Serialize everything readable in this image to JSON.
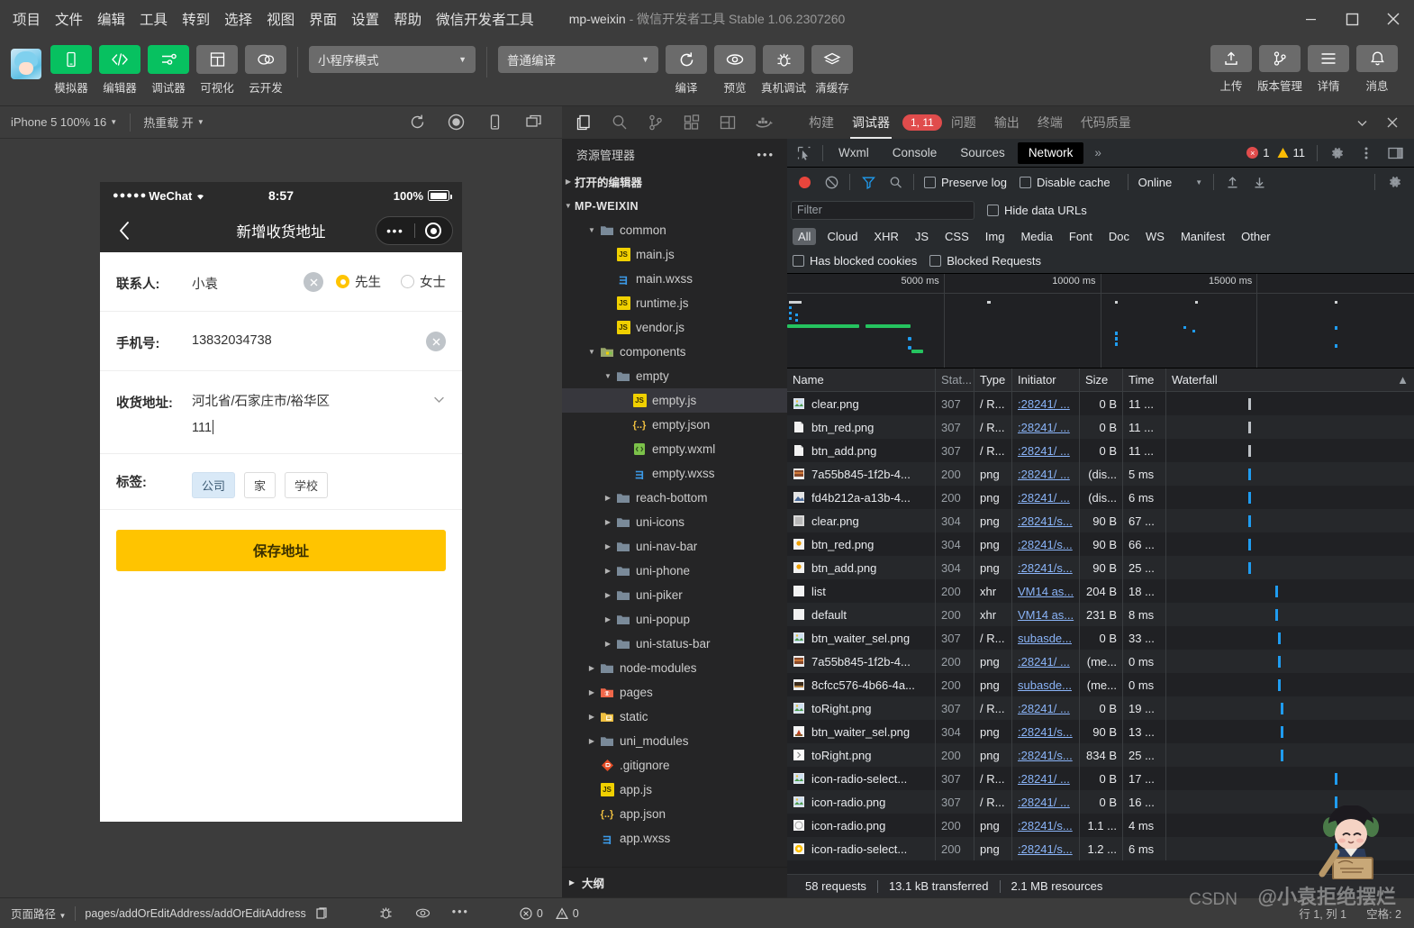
{
  "window": {
    "menu": [
      "项目",
      "文件",
      "编辑",
      "工具",
      "转到",
      "选择",
      "视图",
      "界面",
      "设置",
      "帮助",
      "微信开发者工具"
    ],
    "project_name": "mp-weixin",
    "title_dash": "-",
    "app_title": "微信开发者工具 Stable 1.06.2307260"
  },
  "toolbar": {
    "main_buttons": [
      {
        "label": "模拟器",
        "icon": "phone-icon",
        "style": "green"
      },
      {
        "label": "编辑器",
        "icon": "code-icon",
        "style": "green"
      },
      {
        "label": "调试器",
        "icon": "sliders-icon",
        "style": "green"
      },
      {
        "label": "可视化",
        "icon": "layout-icon",
        "style": "grey"
      },
      {
        "label": "云开发",
        "icon": "cloud-icon",
        "style": "grey"
      }
    ],
    "mode_select": "小程序模式",
    "compile_select": "普通编译",
    "action_buttons": [
      {
        "label": "编译",
        "icon": "refresh-icon"
      },
      {
        "label": "预览",
        "icon": "eye-icon"
      },
      {
        "label": "真机调试",
        "icon": "bug-icon"
      },
      {
        "label": "清缓存",
        "icon": "layers-icon"
      }
    ],
    "right_buttons": [
      {
        "label": "上传",
        "icon": "upload-icon"
      },
      {
        "label": "版本管理",
        "icon": "branch-icon"
      },
      {
        "label": "详情",
        "icon": "menu-icon"
      },
      {
        "label": "消息",
        "icon": "bell-icon"
      }
    ]
  },
  "simulator": {
    "device_select": "iPhone 5 100% 16",
    "hot_reload": "热重载 开",
    "toolbar_icons": [
      "refresh-icon",
      "record-icon",
      "phone-icon",
      "window-icon"
    ],
    "phone": {
      "status_carrier": "WeChat",
      "status_dots": "●●●●●",
      "wifi_icon": "wifi-icon",
      "time": "8:57",
      "battery_pct": "100%",
      "nav_title": "新增收货地址",
      "back_icon": "chevron-left-icon",
      "capsule_more": "•••",
      "capsule_target": "target-icon",
      "form": {
        "contact_label": "联系人:",
        "contact_value": "小袁",
        "clear_icon": "clear-circle-icon",
        "gender_options": [
          {
            "label": "先生",
            "selected": true
          },
          {
            "label": "女士",
            "selected": false
          }
        ],
        "phone_label": "手机号:",
        "phone_value": "13832034738",
        "address_label": "收货地址:",
        "address_region": "河北省/石家庄市/裕华区",
        "address_detail": "111",
        "chevron_icon": "chevron-down-icon",
        "tag_label": "标签:",
        "tags": [
          {
            "label": "公司",
            "selected": true
          },
          {
            "label": "家",
            "selected": false
          },
          {
            "label": "学校",
            "selected": false
          }
        ],
        "save_label": "保存地址"
      }
    }
  },
  "explorer": {
    "activity_icons": [
      "files-icon",
      "search-icon",
      "source-control-icon",
      "extensions-icon",
      "layout-icon",
      "docker-icon"
    ],
    "title": "资源管理器",
    "more_icon": "•••",
    "open_editors": "打开的编辑器",
    "root": "MP-WEIXIN",
    "outline": "大纲",
    "tree": [
      {
        "label": "common",
        "type": "folder",
        "depth": 1,
        "open": true
      },
      {
        "label": "main.js",
        "type": "js",
        "depth": 2
      },
      {
        "label": "main.wxss",
        "type": "css",
        "depth": 2
      },
      {
        "label": "runtime.js",
        "type": "js",
        "depth": 2
      },
      {
        "label": "vendor.js",
        "type": "js",
        "depth": 2
      },
      {
        "label": "components",
        "type": "folder-components",
        "depth": 1,
        "open": true
      },
      {
        "label": "empty",
        "type": "folder",
        "depth": 2,
        "open": true
      },
      {
        "label": "empty.js",
        "type": "js",
        "depth": 3,
        "selected": true
      },
      {
        "label": "empty.json",
        "type": "json",
        "depth": 3
      },
      {
        "label": "empty.wxml",
        "type": "wxml",
        "depth": 3
      },
      {
        "label": "empty.wxss",
        "type": "css",
        "depth": 3
      },
      {
        "label": "reach-bottom",
        "type": "folder",
        "depth": 2,
        "open": false
      },
      {
        "label": "uni-icons",
        "type": "folder",
        "depth": 2,
        "open": false
      },
      {
        "label": "uni-nav-bar",
        "type": "folder",
        "depth": 2,
        "open": false
      },
      {
        "label": "uni-phone",
        "type": "folder",
        "depth": 2,
        "open": false
      },
      {
        "label": "uni-piker",
        "type": "folder",
        "depth": 2,
        "open": false
      },
      {
        "label": "uni-popup",
        "type": "folder",
        "depth": 2,
        "open": false
      },
      {
        "label": "uni-status-bar",
        "type": "folder",
        "depth": 2,
        "open": false
      },
      {
        "label": "node-modules",
        "type": "folder",
        "depth": 1,
        "open": false
      },
      {
        "label": "pages",
        "type": "folder-pages",
        "depth": 1,
        "open": false
      },
      {
        "label": "static",
        "type": "folder-static",
        "depth": 1,
        "open": false
      },
      {
        "label": "uni_modules",
        "type": "folder",
        "depth": 1,
        "open": false
      },
      {
        "label": ".gitignore",
        "type": "git",
        "depth": 1
      },
      {
        "label": "app.js",
        "type": "js",
        "depth": 1
      },
      {
        "label": "app.json",
        "type": "json",
        "depth": 1
      },
      {
        "label": "app.wxss",
        "type": "css",
        "depth": 1
      }
    ]
  },
  "devtools": {
    "tabs": [
      {
        "label": "构建",
        "active": false
      },
      {
        "label": "调试器",
        "active": true,
        "badge": "1, 11"
      },
      {
        "label": "问题",
        "active": false
      },
      {
        "label": "输出",
        "active": false
      },
      {
        "label": "终端",
        "active": false
      },
      {
        "label": "代码质量",
        "active": false
      }
    ],
    "collapse_icon": "chevron-down-icon",
    "close_icon": "close-icon",
    "panel_tabs": [
      {
        "label": "Wxml",
        "selected": false
      },
      {
        "label": "Console",
        "selected": false
      },
      {
        "label": "Sources",
        "selected": false
      },
      {
        "label": "Network",
        "selected": true
      }
    ],
    "more_tabs": "»",
    "inspect_icon": "inspect-icon",
    "error_count": "1",
    "warning_count": "11",
    "settings_icon": "gear-icon",
    "kebab_icon": "kebab-icon",
    "dock_icon": "dock-icon",
    "network": {
      "record_icon": "record-icon",
      "clear_icon": "clear-icon",
      "filter_icon": "filter-icon",
      "search_icon": "search-icon",
      "preserve_log": "Preserve log",
      "disable_cache": "Disable cache",
      "throttle": "Online",
      "import_icon": "upload-arrow-icon",
      "export_icon": "download-arrow-icon",
      "gear_icon": "gear-icon",
      "filter_placeholder": "Filter",
      "hide_data_urls": "Hide data URLs",
      "types": [
        "All",
        "Cloud",
        "XHR",
        "JS",
        "CSS",
        "Img",
        "Media",
        "Font",
        "Doc",
        "WS",
        "Manifest",
        "Other"
      ],
      "selected_type": "All",
      "has_blocked_cookies": "Has blocked cookies",
      "blocked_requests": "Blocked Requests",
      "timeline_ticks": [
        "5000 ms",
        "10000 ms",
        "15000 ms"
      ],
      "columns": [
        "Name",
        "Stat...",
        "Type",
        "Initiator",
        "Size",
        "Time",
        "Waterfall"
      ],
      "sort_icon": "▲",
      "requests": [
        {
          "name": "clear.png",
          "status": "307",
          "type": "/ R...",
          "initiator": ":28241/ ...",
          "size": "0 B",
          "time": "11 ...",
          "icon": "img",
          "wf": 33,
          "wfcolor": "#bdc1c6"
        },
        {
          "name": "btn_red.png",
          "status": "307",
          "type": "/ R...",
          "initiator": ":28241/ ...",
          "size": "0 B",
          "time": "11 ...",
          "icon": "doc",
          "wf": 33,
          "wfcolor": "#bdc1c6"
        },
        {
          "name": "btn_add.png",
          "status": "307",
          "type": "/ R...",
          "initiator": ":28241/ ...",
          "size": "0 B",
          "time": "11 ...",
          "icon": "doc",
          "wf": 33,
          "wfcolor": "#bdc1c6"
        },
        {
          "name": "7a55b845-1f2b-4...",
          "status": "200",
          "type": "png",
          "initiator": ":28241/ ...",
          "size": "(dis...",
          "time": "5 ms",
          "icon": "pic1",
          "wf": 33,
          "wfcolor": "#1f9cf0"
        },
        {
          "name": "fd4b212a-a13b-4...",
          "status": "200",
          "type": "png",
          "initiator": ":28241/ ...",
          "size": "(dis...",
          "time": "6 ms",
          "icon": "pic2",
          "wf": 33,
          "wfcolor": "#1f9cf0"
        },
        {
          "name": "clear.png",
          "status": "304",
          "type": "png",
          "initiator": ":28241/s...",
          "size": "90 B",
          "time": "67 ...",
          "icon": "grey",
          "wf": 33,
          "wfcolor": "#1f9cf0"
        },
        {
          "name": "btn_red.png",
          "status": "304",
          "type": "png",
          "initiator": ":28241/s...",
          "size": "90 B",
          "time": "66 ...",
          "icon": "dot",
          "wf": 33,
          "wfcolor": "#1f9cf0"
        },
        {
          "name": "btn_add.png",
          "status": "304",
          "type": "png",
          "initiator": ":28241/s...",
          "size": "90 B",
          "time": "25 ...",
          "icon": "dot",
          "wf": 33,
          "wfcolor": "#1f9cf0"
        },
        {
          "name": "list",
          "status": "200",
          "type": "xhr",
          "initiator": "VM14 as...",
          "size": "204 B",
          "time": "18 ...",
          "icon": "white",
          "wf": 44,
          "wfcolor": "#1f9cf0"
        },
        {
          "name": "default",
          "status": "200",
          "type": "xhr",
          "initiator": "VM14 as...",
          "size": "231 B",
          "time": "8 ms",
          "icon": "white",
          "wf": 44,
          "wfcolor": "#1f9cf0"
        },
        {
          "name": "btn_waiter_sel.png",
          "status": "307",
          "type": "/ R...",
          "initiator": "subasde...",
          "size": "0 B",
          "time": "33 ...",
          "icon": "img",
          "wf": 45,
          "wfcolor": "#1f9cf0"
        },
        {
          "name": "7a55b845-1f2b-4...",
          "status": "200",
          "type": "png",
          "initiator": ":28241/ ...",
          "size": "(me...",
          "time": "0 ms",
          "icon": "pic1",
          "wf": 45,
          "wfcolor": "#1f9cf0"
        },
        {
          "name": "8cfcc576-4b66-4a...",
          "status": "200",
          "type": "png",
          "initiator": "subasde...",
          "size": "(me...",
          "time": "0 ms",
          "icon": "pic3",
          "wf": 45,
          "wfcolor": "#1f9cf0"
        },
        {
          "name": "toRight.png",
          "status": "307",
          "type": "/ R...",
          "initiator": ":28241/ ...",
          "size": "0 B",
          "time": "19 ...",
          "icon": "img",
          "wf": 46,
          "wfcolor": "#1f9cf0"
        },
        {
          "name": "btn_waiter_sel.png",
          "status": "304",
          "type": "png",
          "initiator": ":28241/s...",
          "size": "90 B",
          "time": "13 ...",
          "icon": "pic4",
          "wf": 46,
          "wfcolor": "#1f9cf0"
        },
        {
          "name": "toRight.png",
          "status": "200",
          "type": "png",
          "initiator": ":28241/s...",
          "size": "834 B",
          "time": "25 ...",
          "icon": "arrw",
          "wf": 46,
          "wfcolor": "#1f9cf0"
        },
        {
          "name": "icon-radio-select...",
          "status": "307",
          "type": "/ R...",
          "initiator": ":28241/ ...",
          "size": "0 B",
          "time": "17 ...",
          "icon": "img",
          "wf": 68,
          "wfcolor": "#1f9cf0"
        },
        {
          "name": "icon-radio.png",
          "status": "307",
          "type": "/ R...",
          "initiator": ":28241/ ...",
          "size": "0 B",
          "time": "16 ...",
          "icon": "img",
          "wf": 68,
          "wfcolor": "#1f9cf0"
        },
        {
          "name": "icon-radio.png",
          "status": "200",
          "type": "png",
          "initiator": ":28241/s...",
          "size": "1.1 ...",
          "time": "4 ms",
          "icon": "circ",
          "wf": 68,
          "wfcolor": "#1f9cf0"
        },
        {
          "name": "icon-radio-select...",
          "status": "200",
          "type": "png",
          "initiator": ":28241/s...",
          "size": "1.2 ...",
          "time": "6 ms",
          "icon": "ycirc",
          "wf": 68,
          "wfcolor": "#1f9cf0"
        }
      ],
      "summary": {
        "requests": "58 requests",
        "transferred": "13.1 kB transferred",
        "resources": "2.1 MB resources"
      }
    }
  },
  "statusbar": {
    "page_path_label": "页面路径",
    "page_path": "pages/addOrEditAddress/addOrEditAddress",
    "copy_icon": "copy-icon",
    "icons": [
      "bug-icon",
      "eye-icon",
      "more-icon"
    ],
    "problems_error": "0",
    "problems_warning": "0",
    "cursor_pos": "行 1, 列 1",
    "indent": "空格: 2"
  },
  "watermark": {
    "csdn": "CSDN",
    "handle": "@小袁拒绝摆烂"
  },
  "colors": {
    "accent_green": "#07c160",
    "accent_yellow": "#ffc400",
    "error_red": "#e04c4c",
    "link_blue": "#8ab4f8"
  }
}
